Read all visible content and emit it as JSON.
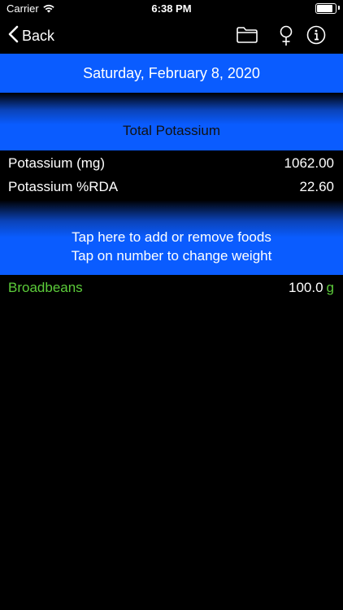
{
  "status_bar": {
    "carrier": "Carrier",
    "time": "6:38 PM",
    "battery_level": 0.95
  },
  "nav": {
    "back_label": "Back",
    "icons": [
      "folder-icon",
      "female-icon",
      "info-icon"
    ]
  },
  "date": "Saturday, February 8, 2020",
  "total_title": "Total Potassium",
  "nutrients": [
    {
      "name": "Potassium (mg)",
      "value": "1062.00"
    },
    {
      "name": "Potassium %RDA",
      "value": "22.60"
    }
  ],
  "instructions": {
    "line1": "Tap here to add or remove foods",
    "line2": "Tap on number to change weight"
  },
  "foods": [
    {
      "name": "Broadbeans",
      "weight": "100.0",
      "unit": "g"
    }
  ],
  "colors": {
    "accent_blue": "#0a5cff",
    "food_green": "#5ccc3a",
    "background": "#000000"
  }
}
